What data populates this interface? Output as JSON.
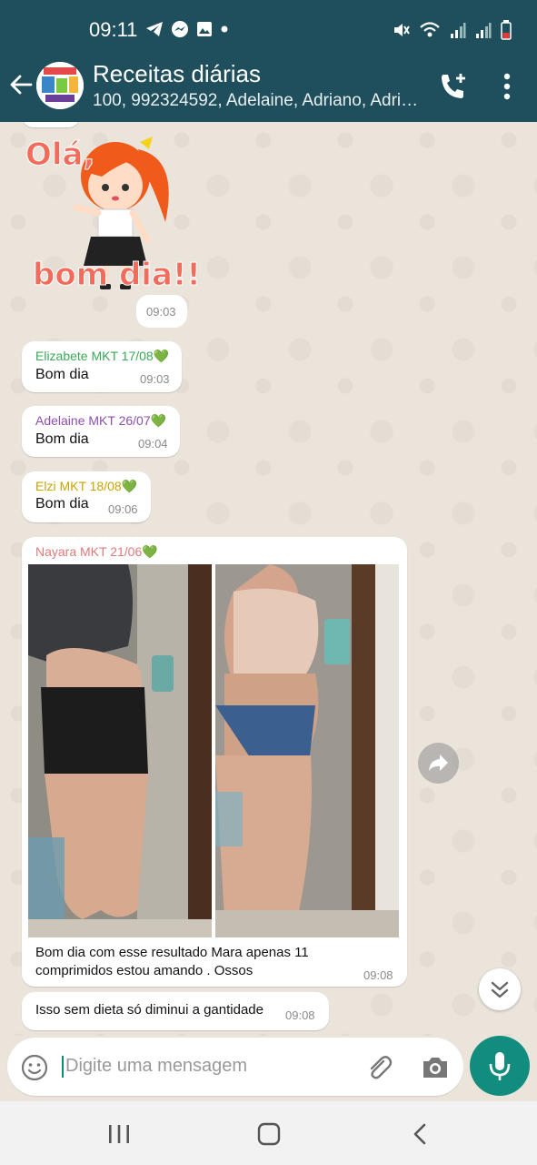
{
  "status_bar": {
    "time": "09:11",
    "left_icons": [
      "telegram-icon",
      "messenger-icon",
      "image-icon",
      "dot-icon"
    ],
    "right_icons": [
      "mute-icon",
      "wifi-icon",
      "signal-icon",
      "signal-icon-2",
      "battery-icon"
    ]
  },
  "header": {
    "title": "Receitas diárias",
    "subtitle": "100, 992324592, Adelaine, Adriano, Adrie...",
    "icons": [
      "back-arrow-icon",
      "add-call-icon",
      "more-vert-icon"
    ]
  },
  "messages": [
    {
      "type": "sticker",
      "sticker_text_top": "Olá,",
      "sticker_text_bottom": "bom dia!!",
      "time": "09:03"
    },
    {
      "type": "text",
      "sender": "Elizabete MKT 17/08💚",
      "sender_color": "#3aa858",
      "text": "Bom dia",
      "time": "09:03"
    },
    {
      "type": "text",
      "sender": "Adelaine MKT 26/07💚",
      "sender_color": "#8e4fb0",
      "text": "Bom dia",
      "time": "09:04"
    },
    {
      "type": "text",
      "sender": "Elzi MKT 18/08💚",
      "sender_color": "#c9a300",
      "text": "Bom dia",
      "time": "09:06"
    },
    {
      "type": "image",
      "sender": "Nayara MKT 21/06💚",
      "sender_color": "#e07a7a",
      "caption_line1": "Bom dia com esse resultado Mara apenas 11",
      "caption_line2": "comprimidos estou amando . Ossos",
      "time": "09:08"
    },
    {
      "type": "text",
      "text": "Isso sem dieta só diminui a gantidade",
      "time": "09:08"
    }
  ],
  "composer": {
    "placeholder": "Digite uma mensagem",
    "icons": [
      "emoji-icon",
      "attach-icon",
      "camera-icon",
      "mic-icon"
    ]
  },
  "nav_bar": {
    "icons": [
      "recent-apps-icon",
      "home-icon",
      "back-icon"
    ]
  },
  "colors": {
    "header_bg": "#1f4f5c",
    "accent": "#128c7e",
    "chat_bg": "#ebe4db"
  }
}
